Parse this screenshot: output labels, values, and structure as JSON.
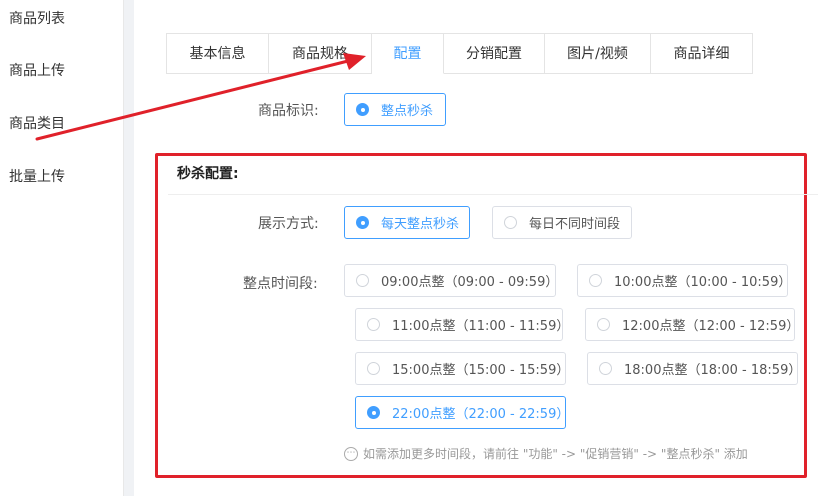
{
  "sidebar": {
    "items": [
      {
        "label": "商品列表"
      },
      {
        "label": "商品上传"
      },
      {
        "label": "商品类目"
      },
      {
        "label": "批量上传"
      }
    ]
  },
  "tabs": [
    {
      "label": "基本信息",
      "active": false
    },
    {
      "label": "商品规格",
      "active": false
    },
    {
      "label": "配置",
      "active": true
    },
    {
      "label": "分销配置",
      "active": false
    },
    {
      "label": "图片/视频",
      "active": false
    },
    {
      "label": "商品详细",
      "active": false
    }
  ],
  "product_tag": {
    "label": "商品标识:",
    "option": "整点秒杀",
    "selected": true
  },
  "flash_sale_config": {
    "title": "秒杀配置:",
    "display_mode": {
      "label": "展示方式:",
      "options": [
        {
          "label": "每天整点秒杀",
          "selected": true
        },
        {
          "label": "每日不同时间段",
          "selected": false
        }
      ]
    },
    "time_slots": {
      "label": "整点时间段:",
      "options": [
        {
          "label": "09:00点整（09:00 - 09:59）",
          "selected": false
        },
        {
          "label": "10:00点整（10:00 - 10:59）",
          "selected": false
        },
        {
          "label": "11:00点整（11:00 - 11:59）",
          "selected": false
        },
        {
          "label": "12:00点整（12:00 - 12:59）",
          "selected": false
        },
        {
          "label": "15:00点整（15:00 - 15:59）",
          "selected": false
        },
        {
          "label": "18:00点整（18:00 - 18:59）",
          "selected": false
        },
        {
          "label": "22:00点整（22:00 - 22:59）",
          "selected": true
        }
      ]
    },
    "hint": "如需添加更多时间段，请前往 \"功能\" -> \"促销营销\" -> \"整点秒杀\" 添加"
  },
  "colors": {
    "primary": "#409eff",
    "annotation": "#e0212a"
  }
}
